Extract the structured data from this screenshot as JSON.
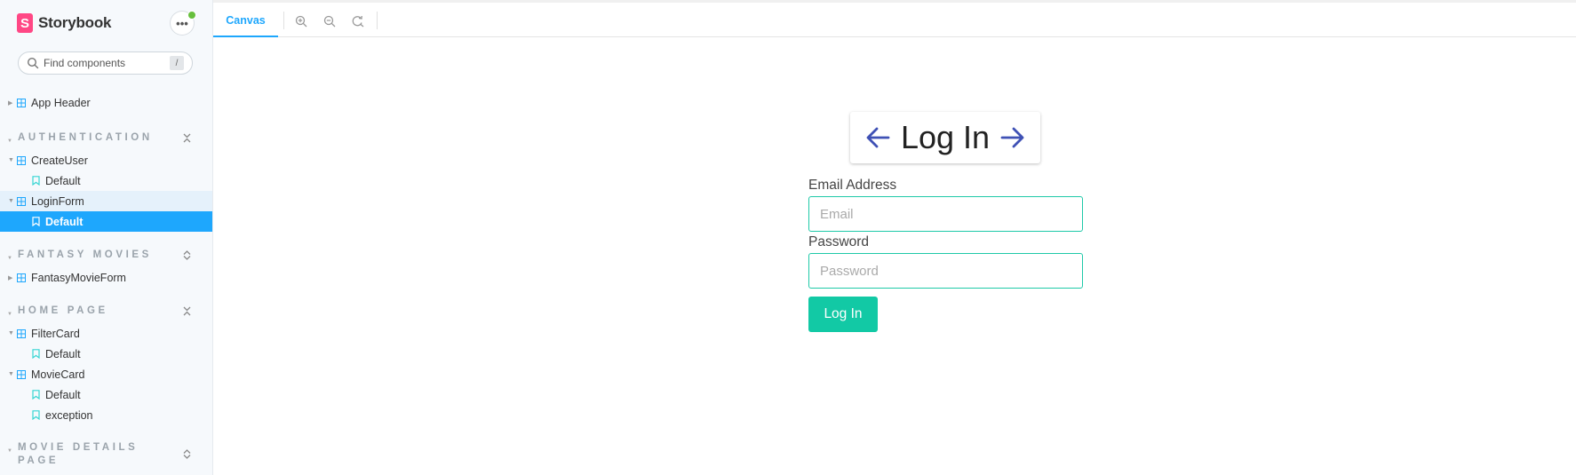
{
  "sidebar": {
    "brand": "Storybook",
    "menu_glyph": "•••",
    "search": {
      "placeholder": "Find components",
      "shortcut": "/"
    },
    "tree": {
      "app_header": "App Header",
      "groups": {
        "authentication": "AUTHENTICATION",
        "fantasy_movies": "FANTASY MOVIES",
        "home_page": "HOME PAGE",
        "movie_details_page": "MOVIE DETAILS PAGE"
      },
      "create_user": "CreateUser",
      "create_user_default": "Default",
      "login_form": "LoginForm",
      "login_form_default": "Default",
      "fantasy_movie_form": "FantasyMovieForm",
      "filter_card": "FilterCard",
      "filter_card_default": "Default",
      "movie_card": "MovieCard",
      "movie_card_default": "Default",
      "movie_card_exception": "exception"
    }
  },
  "toolbar": {
    "tab_canvas": "Canvas"
  },
  "canvas": {
    "title": "Log In",
    "email_label": "Email Address",
    "email_placeholder": "Email",
    "password_label": "Password",
    "password_placeholder": "Password",
    "submit_label": "Log In"
  },
  "colors": {
    "accent": "#1ea7fd",
    "brand": "#ff4785",
    "button": "#12c9a5",
    "input_border": "#1ec9a8",
    "arrow": "#3f51b5"
  }
}
